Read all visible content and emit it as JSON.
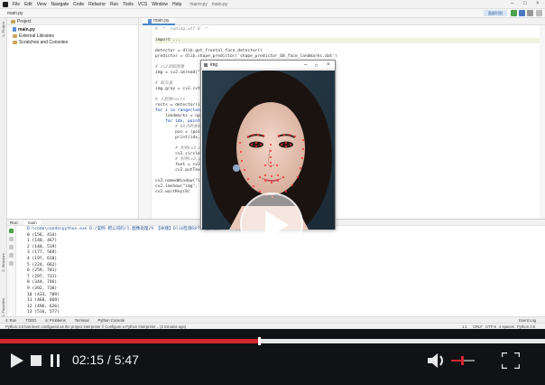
{
  "menubar": {
    "items": [
      "File",
      "Edit",
      "View",
      "Navigate",
      "Code",
      "Refactor",
      "Run",
      "Tools",
      "VCS",
      "Window",
      "Help"
    ],
    "project": "mann-py",
    "file": "main.py"
  },
  "nav": {
    "breadcrumb": "main.py",
    "profile": "面部识别"
  },
  "project_panel": {
    "header": "Project",
    "items": [
      "main.py",
      "External Libraries",
      "Scratches and Consoles"
    ]
  },
  "editor": {
    "tab": "main.py",
    "lines": [
      {
        "t": "# -*- coding:utf-8 -*-",
        "c": "cmt"
      },
      {
        "t": "",
        "c": ""
      },
      {
        "t": "import ...",
        "c": "imp"
      },
      {
        "t": "",
        "c": ""
      },
      {
        "t": "detector = dlib.get_frontal_face_detector()",
        "c": ""
      },
      {
        "t": "predictor = dlib.shape_predictor('shape_predictor_68_face_landmarks.dat')",
        "c": ""
      },
      {
        "t": "",
        "c": ""
      },
      {
        "t": "# cv2读取图像",
        "c": "cmt"
      },
      {
        "t": "img = cv2.imread(\"1",
        "c": ""
      },
      {
        "t": "",
        "c": ""
      },
      {
        "t": "# 取灰度",
        "c": "cmt"
      },
      {
        "t": "img_gray = cv2.cvtC",
        "c": ""
      },
      {
        "t": "",
        "c": ""
      },
      {
        "t": "# 人脸数rects",
        "c": "cmt"
      },
      {
        "t": "rects = detector(im",
        "c": ""
      },
      {
        "t": "for i in range(len(",
        "c": "kw"
      },
      {
        "t": "    landmarks = np.",
        "c": ""
      },
      {
        "t": "    for idx, point",
        "c": "kw"
      },
      {
        "t": "        # 68点的坐标",
        "c": "cmt"
      },
      {
        "t": "        pos = (point",
        "c": ""
      },
      {
        "t": "        print(idx,po",
        "c": ""
      },
      {
        "t": "",
        "c": ""
      },
      {
        "t": "        # 利用cv2.circ",
        "c": "cmt"
      },
      {
        "t": "        cv2.circle(",
        "c": ""
      },
      {
        "t": "        # 利用cv2.pu",
        "c": "cmt"
      },
      {
        "t": "        font = cv2.F",
        "c": ""
      },
      {
        "t": "        cv2.putText(",
        "c": ""
      },
      {
        "t": "",
        "c": ""
      },
      {
        "t": "cv2.namedWindow(\"img",
        "c": ""
      },
      {
        "t": "cv2.imshow(\"img\", im",
        "c": ""
      },
      {
        "t": "cv2.waitKey(0)",
        "c": ""
      }
    ]
  },
  "run": {
    "tab_label": "Run:",
    "config": "main",
    "console": [
      "D:\\code\\conda\\python.exe D:/案例-把公司的/1.图像处理/9.【OK版】Dlib检测68个人脸关键点/main.py",
      "0 (156, 414)",
      "1 (148, 467)",
      "2 (148, 519)",
      "3 (177, 569)",
      "4 (197, 618)",
      "5 (224, 662)",
      "6 (259, 701)",
      "7 (297, 731)",
      "8 (344, 746)",
      "9 (392, 738)",
      "10 (433, 709)",
      "11 (468, 669)",
      "12 (496, 626)",
      "13 (516, 577)"
    ]
  },
  "bottom_tabs": [
    "4: Run",
    "TODO",
    "6: Problems",
    "Terminal",
    "Python Console"
  ],
  "event_log": "Event Log",
  "status": {
    "message": "Python 3.8 has been configured as the project interpreter // Configure a Python Interpreter... (3 minutes ago)",
    "right": [
      "1:1",
      "CRLF",
      "UTF-8",
      "4 spaces",
      "Python 3.8"
    ]
  },
  "img_window": {
    "title": "img"
  },
  "side_tabs": [
    "1: Project",
    "2: Structure",
    "2: Favorites"
  ],
  "player": {
    "current_time": "02:15",
    "separator": " / ",
    "total_time": "5:47",
    "progress": 0.4755,
    "accent_color": "#d3262e"
  }
}
